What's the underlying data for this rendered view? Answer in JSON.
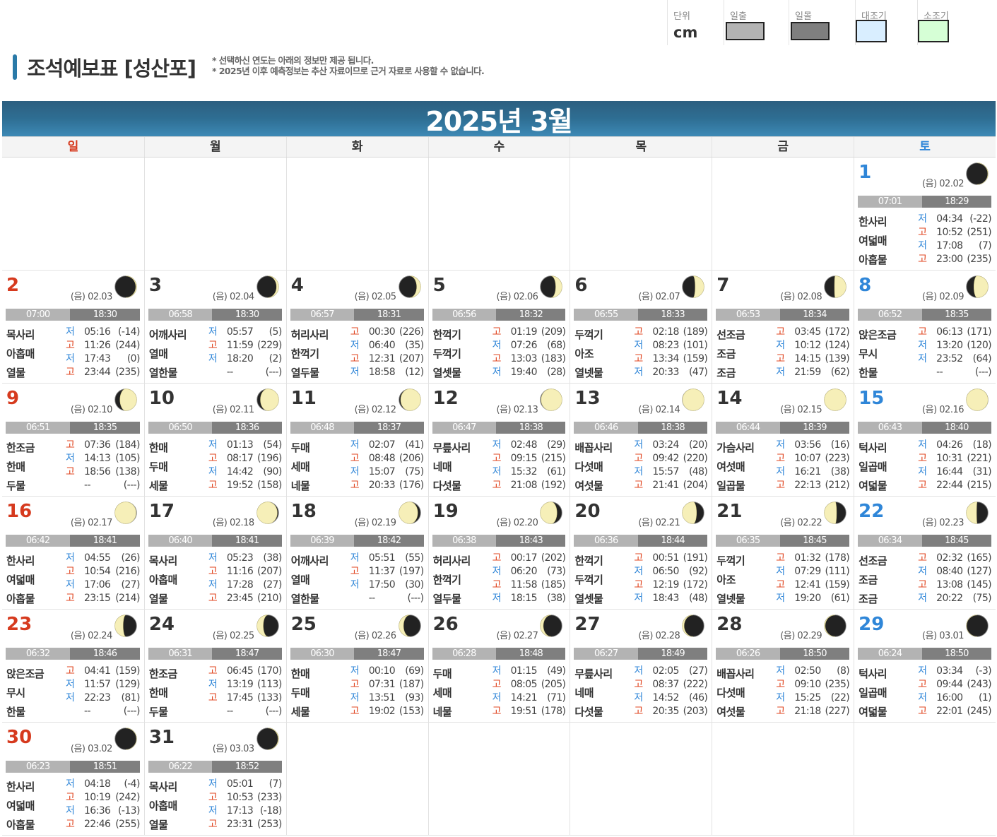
{
  "legend": {
    "unit_label": "단위",
    "unit_value": "cm",
    "sunrise_label": "일출",
    "sunset_label": "일몰",
    "spring_label": "대조기",
    "neap_label": "소조기",
    "colors": {
      "sunrise": "#b3b3b3",
      "sunset": "#7f7f7f",
      "spring": "#d9eeff",
      "neap": "#d6ffd6"
    }
  },
  "title": "조석예보표 [성산포]",
  "notes": [
    "* 선택하신 연도는 아래의 정보만 제공 됩니다.",
    "* 2025년 이후 예측정보는 추산 자료이므로 근거 자료로 사용할 수 없습니다."
  ],
  "calendar": {
    "month_title": "2025년 3월",
    "weekdays": [
      "일",
      "월",
      "화",
      "수",
      "목",
      "금",
      "토"
    ],
    "first_weekday": 6,
    "days": [
      {
        "day": "1",
        "lunar": "(음) 02.02",
        "phase": 0.03,
        "sunrise": "07:01",
        "sunset": "18:29",
        "labels": [
          "한사리",
          "여덟매",
          "아홉물"
        ],
        "tides": [
          [
            "저",
            "04:34",
            "(-22)"
          ],
          [
            "고",
            "10:52",
            "(251)"
          ],
          [
            "저",
            "17:08",
            "(7)"
          ],
          [
            "고",
            "23:00",
            "(235)"
          ]
        ]
      },
      {
        "day": "2",
        "lunar": "(음) 02.03",
        "phase": 0.06,
        "sunrise": "07:00",
        "sunset": "18:30",
        "labels": [
          "목사리",
          "아홉매",
          "열물"
        ],
        "tides": [
          [
            "저",
            "05:16",
            "(-14)"
          ],
          [
            "고",
            "11:26",
            "(244)"
          ],
          [
            "저",
            "17:43",
            "(0)"
          ],
          [
            "고",
            "23:44",
            "(235)"
          ]
        ]
      },
      {
        "day": "3",
        "lunar": "(음) 02.04",
        "phase": 0.1,
        "sunrise": "06:58",
        "sunset": "18:30",
        "labels": [
          "어깨사리",
          "열매",
          "열한물"
        ],
        "tides": [
          [
            "저",
            "05:57",
            "(5)"
          ],
          [
            "고",
            "11:59",
            "(229)"
          ],
          [
            "저",
            "18:20",
            "(2)"
          ],
          [
            "",
            "--",
            "(---)"
          ]
        ]
      },
      {
        "day": "4",
        "lunar": "(음) 02.05",
        "phase": 0.14,
        "sunrise": "06:57",
        "sunset": "18:31",
        "labels": [
          "허리사리",
          "한꺽기",
          "열두물"
        ],
        "tides": [
          [
            "고",
            "00:30",
            "(226)"
          ],
          [
            "저",
            "06:40",
            "(35)"
          ],
          [
            "고",
            "12:31",
            "(207)"
          ],
          [
            "저",
            "18:58",
            "(12)"
          ]
        ]
      },
      {
        "day": "5",
        "lunar": "(음) 02.06",
        "phase": 0.18,
        "sunrise": "06:56",
        "sunset": "18:32",
        "labels": [
          "한꺽기",
          "두꺽기",
          "열셋물"
        ],
        "tides": [
          [
            "고",
            "01:19",
            "(209)"
          ],
          [
            "저",
            "07:26",
            "(68)"
          ],
          [
            "고",
            "13:03",
            "(183)"
          ],
          [
            "저",
            "19:40",
            "(28)"
          ]
        ]
      },
      {
        "day": "6",
        "lunar": "(음) 02.07",
        "phase": 0.22,
        "sunrise": "06:55",
        "sunset": "18:33",
        "labels": [
          "두꺽기",
          "아조",
          "열넷물"
        ],
        "tides": [
          [
            "고",
            "02:18",
            "(189)"
          ],
          [
            "저",
            "08:23",
            "(101)"
          ],
          [
            "고",
            "13:34",
            "(159)"
          ],
          [
            "저",
            "20:33",
            "(47)"
          ]
        ]
      },
      {
        "day": "7",
        "lunar": "(음) 02.08",
        "phase": 0.26,
        "sunrise": "06:53",
        "sunset": "18:34",
        "labels": [
          "선조금",
          "조금",
          "조금"
        ],
        "tides": [
          [
            "고",
            "03:45",
            "(172)"
          ],
          [
            "저",
            "10:12",
            "(124)"
          ],
          [
            "고",
            "14:15",
            "(139)"
          ],
          [
            "저",
            "21:59",
            "(62)"
          ]
        ]
      },
      {
        "day": "8",
        "lunar": "(음) 02.09",
        "phase": 0.3,
        "sunrise": "06:52",
        "sunset": "18:35",
        "labels": [
          "앉은조금",
          "무시",
          "한물"
        ],
        "tides": [
          [
            "고",
            "06:13",
            "(171)"
          ],
          [
            "저",
            "13:20",
            "(120)"
          ],
          [
            "저",
            "23:52",
            "(64)"
          ],
          [
            "",
            "--",
            "(---)"
          ]
        ]
      },
      {
        "day": "9",
        "lunar": "(음) 02.10",
        "phase": 0.34,
        "sunrise": "06:51",
        "sunset": "18:35",
        "labels": [
          "한조금",
          "한매",
          "두물"
        ],
        "tides": [
          [
            "고",
            "07:36",
            "(184)"
          ],
          [
            "저",
            "14:13",
            "(105)"
          ],
          [
            "고",
            "18:56",
            "(138)"
          ],
          [
            "",
            "--",
            "(---)"
          ]
        ]
      },
      {
        "day": "10",
        "lunar": "(음) 02.11",
        "phase": 0.37,
        "sunrise": "06:50",
        "sunset": "18:36",
        "labels": [
          "한매",
          "두매",
          "세물"
        ],
        "tides": [
          [
            "저",
            "01:13",
            "(54)"
          ],
          [
            "고",
            "08:17",
            "(196)"
          ],
          [
            "저",
            "14:42",
            "(90)"
          ],
          [
            "고",
            "19:52",
            "(158)"
          ]
        ]
      },
      {
        "day": "11",
        "lunar": "(음) 02.12",
        "phase": 0.41,
        "sunrise": "06:48",
        "sunset": "18:37",
        "labels": [
          "두매",
          "세매",
          "네물"
        ],
        "tides": [
          [
            "저",
            "02:07",
            "(41)"
          ],
          [
            "고",
            "08:48",
            "(206)"
          ],
          [
            "저",
            "15:07",
            "(75)"
          ],
          [
            "고",
            "20:33",
            "(176)"
          ]
        ]
      },
      {
        "day": "12",
        "lunar": "(음) 02.13",
        "phase": 0.44,
        "sunrise": "06:47",
        "sunset": "18:38",
        "labels": [
          "무릎사리",
          "네매",
          "다섯물"
        ],
        "tides": [
          [
            "저",
            "02:48",
            "(29)"
          ],
          [
            "고",
            "09:15",
            "(215)"
          ],
          [
            "저",
            "15:32",
            "(61)"
          ],
          [
            "고",
            "21:08",
            "(192)"
          ]
        ]
      },
      {
        "day": "13",
        "lunar": "(음) 02.14",
        "phase": 0.47,
        "sunrise": "06:46",
        "sunset": "18:38",
        "labels": [
          "배꼽사리",
          "다섯매",
          "여섯물"
        ],
        "tides": [
          [
            "저",
            "03:24",
            "(20)"
          ],
          [
            "고",
            "09:42",
            "(220)"
          ],
          [
            "저",
            "15:57",
            "(48)"
          ],
          [
            "고",
            "21:41",
            "(204)"
          ]
        ]
      },
      {
        "day": "14",
        "lunar": "(음) 02.15",
        "phase": 0.5,
        "sunrise": "06:44",
        "sunset": "18:39",
        "labels": [
          "가슴사리",
          "여섯매",
          "일곱물"
        ],
        "tides": [
          [
            "저",
            "03:56",
            "(16)"
          ],
          [
            "고",
            "10:07",
            "(223)"
          ],
          [
            "저",
            "16:21",
            "(38)"
          ],
          [
            "고",
            "22:13",
            "(212)"
          ]
        ]
      },
      {
        "day": "15",
        "lunar": "(음) 02.16",
        "phase": 0.52,
        "sunrise": "06:43",
        "sunset": "18:40",
        "labels": [
          "턱사리",
          "일곱매",
          "여덟물"
        ],
        "tides": [
          [
            "저",
            "04:26",
            "(18)"
          ],
          [
            "고",
            "10:31",
            "(221)"
          ],
          [
            "저",
            "16:44",
            "(31)"
          ],
          [
            "고",
            "22:44",
            "(215)"
          ]
        ]
      },
      {
        "day": "16",
        "lunar": "(음) 02.17",
        "phase": 0.55,
        "sunrise": "06:42",
        "sunset": "18:41",
        "labels": [
          "한사리",
          "여덟매",
          "아홉물"
        ],
        "tides": [
          [
            "저",
            "04:55",
            "(26)"
          ],
          [
            "고",
            "10:54",
            "(216)"
          ],
          [
            "저",
            "17:06",
            "(27)"
          ],
          [
            "고",
            "23:15",
            "(214)"
          ]
        ]
      },
      {
        "day": "17",
        "lunar": "(음) 02.18",
        "phase": 0.58,
        "sunrise": "06:40",
        "sunset": "18:41",
        "labels": [
          "목사리",
          "아홉매",
          "열물"
        ],
        "tides": [
          [
            "저",
            "05:23",
            "(38)"
          ],
          [
            "고",
            "11:16",
            "(207)"
          ],
          [
            "저",
            "17:28",
            "(27)"
          ],
          [
            "고",
            "23:45",
            "(210)"
          ]
        ]
      },
      {
        "day": "18",
        "lunar": "(음) 02.19",
        "phase": 0.62,
        "sunrise": "06:39",
        "sunset": "18:42",
        "labels": [
          "어깨사리",
          "열매",
          "열한물"
        ],
        "tides": [
          [
            "저",
            "05:51",
            "(55)"
          ],
          [
            "고",
            "11:37",
            "(197)"
          ],
          [
            "저",
            "17:50",
            "(30)"
          ],
          [
            "",
            "--",
            "(---)"
          ]
        ]
      },
      {
        "day": "19",
        "lunar": "(음) 02.20",
        "phase": 0.66,
        "sunrise": "06:38",
        "sunset": "18:43",
        "labels": [
          "허리사리",
          "한꺽기",
          "열두물"
        ],
        "tides": [
          [
            "고",
            "00:17",
            "(202)"
          ],
          [
            "저",
            "06:20",
            "(73)"
          ],
          [
            "고",
            "11:58",
            "(185)"
          ],
          [
            "저",
            "18:15",
            "(38)"
          ]
        ]
      },
      {
        "day": "20",
        "lunar": "(음) 02.21",
        "phase": 0.7,
        "sunrise": "06:36",
        "sunset": "18:44",
        "labels": [
          "한꺽기",
          "두꺽기",
          "열셋물"
        ],
        "tides": [
          [
            "고",
            "00:51",
            "(191)"
          ],
          [
            "저",
            "06:50",
            "(92)"
          ],
          [
            "고",
            "12:19",
            "(172)"
          ],
          [
            "저",
            "18:43",
            "(48)"
          ]
        ]
      },
      {
        "day": "21",
        "lunar": "(음) 02.22",
        "phase": 0.73,
        "sunrise": "06:35",
        "sunset": "18:45",
        "labels": [
          "두꺽기",
          "아조",
          "열넷물"
        ],
        "tides": [
          [
            "고",
            "01:32",
            "(178)"
          ],
          [
            "저",
            "07:29",
            "(111)"
          ],
          [
            "고",
            "12:41",
            "(159)"
          ],
          [
            "저",
            "19:20",
            "(61)"
          ]
        ]
      },
      {
        "day": "22",
        "lunar": "(음) 02.23",
        "phase": 0.76,
        "sunrise": "06:34",
        "sunset": "18:45",
        "labels": [
          "선조금",
          "조금",
          "조금"
        ],
        "tides": [
          [
            "고",
            "02:32",
            "(165)"
          ],
          [
            "저",
            "08:40",
            "(127)"
          ],
          [
            "고",
            "13:08",
            "(145)"
          ],
          [
            "저",
            "20:22",
            "(75)"
          ]
        ]
      },
      {
        "day": "23",
        "lunar": "(음) 02.24",
        "phase": 0.79,
        "sunrise": "06:32",
        "sunset": "18:46",
        "labels": [
          "앉은조금",
          "무시",
          "한물"
        ],
        "tides": [
          [
            "고",
            "04:41",
            "(159)"
          ],
          [
            "저",
            "11:57",
            "(129)"
          ],
          [
            "저",
            "22:23",
            "(81)"
          ],
          [
            "",
            "--",
            "(---)"
          ]
        ]
      },
      {
        "day": "24",
        "lunar": "(음) 02.25",
        "phase": 0.82,
        "sunrise": "06:31",
        "sunset": "18:47",
        "labels": [
          "한조금",
          "한매",
          "두물"
        ],
        "tides": [
          [
            "고",
            "06:45",
            "(170)"
          ],
          [
            "저",
            "13:19",
            "(113)"
          ],
          [
            "고",
            "17:45",
            "(133)"
          ],
          [
            "",
            "--",
            "(---)"
          ]
        ]
      },
      {
        "day": "25",
        "lunar": "(음) 02.26",
        "phase": 0.85,
        "sunrise": "06:30",
        "sunset": "18:47",
        "labels": [
          "한매",
          "두매",
          "세물"
        ],
        "tides": [
          [
            "저",
            "00:10",
            "(69)"
          ],
          [
            "고",
            "07:31",
            "(187)"
          ],
          [
            "저",
            "13:51",
            "(93)"
          ],
          [
            "고",
            "19:02",
            "(153)"
          ]
        ]
      },
      {
        "day": "26",
        "lunar": "(음) 02.27",
        "phase": 0.88,
        "sunrise": "06:28",
        "sunset": "18:48",
        "labels": [
          "두매",
          "세매",
          "네물"
        ],
        "tides": [
          [
            "저",
            "01:15",
            "(49)"
          ],
          [
            "고",
            "08:05",
            "(205)"
          ],
          [
            "저",
            "14:21",
            "(71)"
          ],
          [
            "고",
            "19:51",
            "(178)"
          ]
        ]
      },
      {
        "day": "27",
        "lunar": "(음) 02.28",
        "phase": 0.91,
        "sunrise": "06:27",
        "sunset": "18:49",
        "labels": [
          "무릎사리",
          "네매",
          "다섯물"
        ],
        "tides": [
          [
            "저",
            "02:05",
            "(27)"
          ],
          [
            "고",
            "08:37",
            "(222)"
          ],
          [
            "저",
            "14:52",
            "(46)"
          ],
          [
            "고",
            "20:35",
            "(203)"
          ]
        ]
      },
      {
        "day": "28",
        "lunar": "(음) 02.29",
        "phase": 0.94,
        "sunrise": "06:26",
        "sunset": "18:50",
        "labels": [
          "배꼽사리",
          "다섯매",
          "여섯물"
        ],
        "tides": [
          [
            "저",
            "02:50",
            "(8)"
          ],
          [
            "고",
            "09:10",
            "(235)"
          ],
          [
            "저",
            "15:25",
            "(22)"
          ],
          [
            "고",
            "21:18",
            "(227)"
          ]
        ]
      },
      {
        "day": "29",
        "lunar": "(음) 03.01",
        "phase": 0.98,
        "sunrise": "06:24",
        "sunset": "18:50",
        "labels": [
          "턱사리",
          "일곱매",
          "여덟물"
        ],
        "tides": [
          [
            "저",
            "03:34",
            "(-3)"
          ],
          [
            "고",
            "09:44",
            "(243)"
          ],
          [
            "저",
            "16:00",
            "(1)"
          ],
          [
            "고",
            "22:01",
            "(245)"
          ]
        ]
      },
      {
        "day": "30",
        "lunar": "(음) 03.02",
        "phase": 0.02,
        "sunrise": "06:23",
        "sunset": "18:51",
        "labels": [
          "한사리",
          "여덟매",
          "아홉물"
        ],
        "tides": [
          [
            "저",
            "04:18",
            "(-4)"
          ],
          [
            "고",
            "10:19",
            "(242)"
          ],
          [
            "저",
            "16:36",
            "(-13)"
          ],
          [
            "고",
            "22:46",
            "(255)"
          ]
        ]
      },
      {
        "day": "31",
        "lunar": "(음) 03.03",
        "phase": 0.05,
        "sunrise": "06:22",
        "sunset": "18:52",
        "labels": [
          "목사리",
          "아홉매",
          "열물"
        ],
        "tides": [
          [
            "저",
            "05:01",
            "(7)"
          ],
          [
            "고",
            "10:53",
            "(233)"
          ],
          [
            "저",
            "17:13",
            "(-18)"
          ],
          [
            "고",
            "23:31",
            "(253)"
          ]
        ]
      }
    ]
  }
}
